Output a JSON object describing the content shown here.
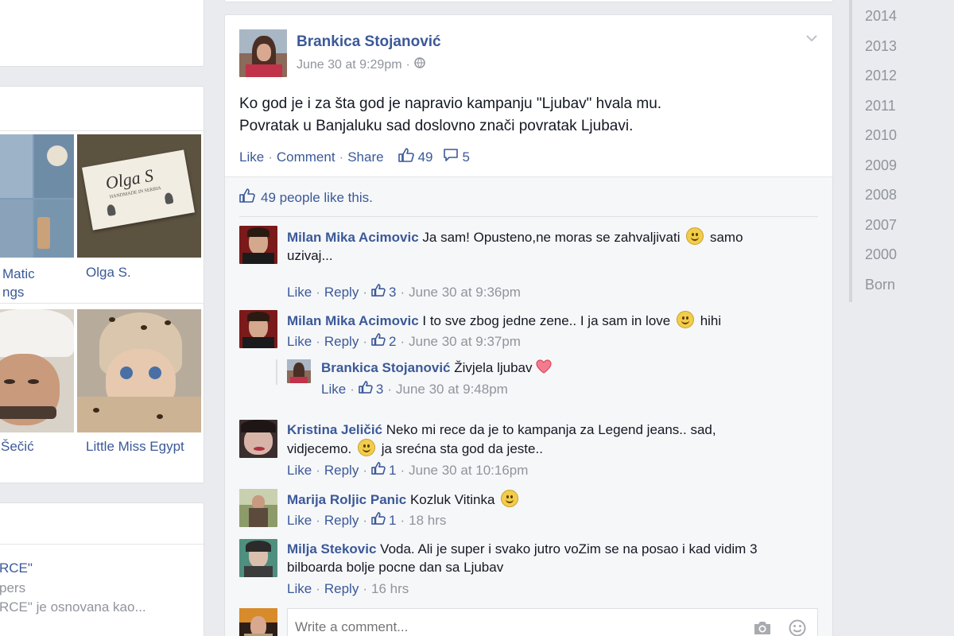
{
  "left_column": {
    "photos": [
      {
        "label": "Matic\nngs"
      },
      {
        "label": "Olga S.",
        "card_title": "Olga S",
        "card_sub": "HANDMADE IN SERBIA"
      },
      {
        "label": "Šečić"
      },
      {
        "label": "Little Miss Egypt"
      }
    ],
    "page_snippet": {
      "line1": "RCE\"",
      "line2": "pers",
      "line3": "RCE\" je osnovana kao..."
    }
  },
  "post": {
    "author": "Brankica Stojanović",
    "time": "June 30 at 9:29pm",
    "dot": "·",
    "text_line1": "Ko god je i za šta god je napravio kampanju \"Ljubav\" hvala mu.",
    "text_line2": "Povratak u Banjaluku sad doslovno znači povratak Ljubavi.",
    "actions": {
      "like": "Like",
      "comment": "Comment",
      "share": "Share",
      "sep": "·",
      "likes": "49",
      "comments": "5"
    },
    "likes_summary": "49 people like this.",
    "comments": [
      {
        "author": "Milan Mika Acimovic",
        "text": "Ja sam! Opusteno,ne moras se zahvaljivati",
        "text2": "samo",
        "text3": "uzivaj...",
        "like": "Like",
        "reply": "Reply",
        "likes": "3",
        "time": "June 30 at 9:36pm"
      },
      {
        "author": "Milan Mika Acimovic",
        "text": "I to sve zbog jedne zene.. I ja sam in love",
        "text2": "hihi",
        "like": "Like",
        "reply": "Reply",
        "likes": "2",
        "time": "June 30 at 9:37pm"
      },
      {
        "author": "Brankica Stojanović",
        "text": "Živjela ljubav",
        "like": "Like",
        "likes": "3",
        "time": "June 30 at 9:48pm"
      },
      {
        "author": "Kristina Jeličić",
        "text": "Neko mi rece da je to kampanja za Legend jeans.. sad,",
        "text2": "vidjecemo.",
        "text3": "ja srećna sta god da jeste..",
        "like": "Like",
        "reply": "Reply",
        "likes": "1",
        "time": "June 30 at 10:16pm"
      },
      {
        "author": "Marija Roljic Panic",
        "text": "Kozluk Vitinka",
        "like": "Like",
        "reply": "Reply",
        "likes": "1",
        "time": "18 hrs"
      },
      {
        "author": "Milja Stekovic",
        "text": "Voda. Ali je super i svako jutro voZim se na posao i kad vidim 3",
        "text2": "bilboarda bolje pocne dan sa Ljubav",
        "like": "Like",
        "reply": "Reply",
        "time": "16 hrs"
      }
    ],
    "comment_input": {
      "placeholder": "Write a comment..."
    }
  },
  "years": [
    "2014",
    "2013",
    "2012",
    "2011",
    "2010",
    "2009",
    "2008",
    "2007",
    "2000",
    "Born"
  ],
  "colors": {
    "link": "#3b5998",
    "muted": "#90949c",
    "background": "#e9ebee"
  }
}
